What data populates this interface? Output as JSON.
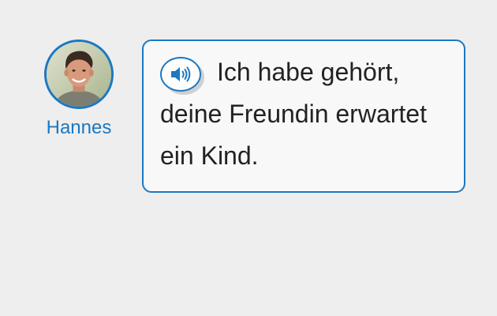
{
  "speaker": {
    "name": "Hannes",
    "avatar_icon": "person-avatar-icon"
  },
  "message": {
    "audio_icon": "speaker-icon",
    "text": "Ich habe gehört, deine Freundin erwartet ein Kind."
  },
  "colors": {
    "accent": "#1b78c2",
    "background": "#eeeeee",
    "bubble_background": "#f8f8f8",
    "text": "#222222"
  }
}
